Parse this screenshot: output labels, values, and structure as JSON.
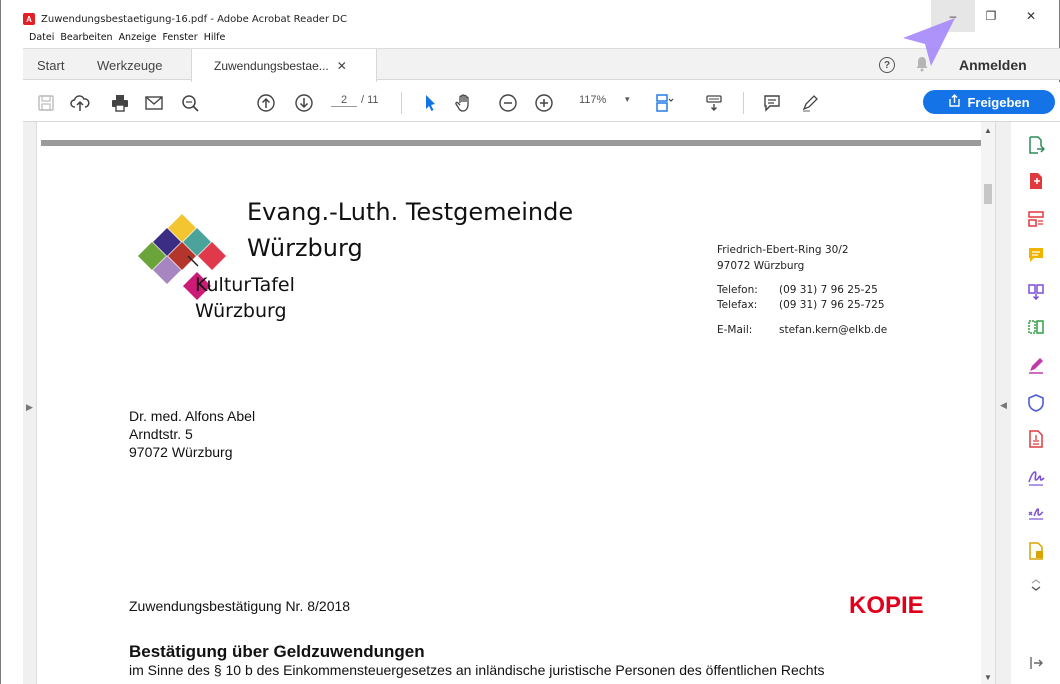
{
  "window": {
    "title": "Zuwendungsbestaetigung-16.pdf - Adobe Acrobat Reader DC",
    "controls": {
      "minimize": "–",
      "maximize": "❐",
      "close": "✕"
    }
  },
  "menu": [
    "Datei",
    "Bearbeiten",
    "Anzeige",
    "Fenster",
    "Hilfe"
  ],
  "tabs": {
    "start": "Start",
    "tools": "Werkzeuge",
    "document": "Zuwendungsbestae...",
    "close": "✕"
  },
  "header": {
    "help": "?",
    "signin": "Anmelden"
  },
  "toolbar": {
    "page_current": "2",
    "page_total": "/ 11",
    "zoom": "117%",
    "zoom_caret": "▾",
    "share_label": "Freigeben"
  },
  "letter": {
    "org_line1": "Evang.-Luth. Testgemeinde",
    "org_line2": "Würzburg",
    "logo_line1": "KulturTafel",
    "logo_line2": "Würzburg",
    "address_line1": "Friedrich-Ebert-Ring 30/2",
    "address_line2": "97072 Würzburg",
    "phone_label": "Telefon:",
    "phone_value": "(09 31) 7 96 25-25",
    "fax_label": "Telefax:",
    "fax_value": "(09 31) 7 96 25-725",
    "email_label": "E-Mail:",
    "email_value": "stefan.kern@elkb.de",
    "recipient_name": "Dr. med. Alfons Abel",
    "recipient_street": "Arndtstr. 5",
    "recipient_city": "97072 Würzburg",
    "confirmation_number": "Zuwendungsbestätigung Nr. 8/2018",
    "stamp": "KOPIE",
    "heading": "Bestätigung über Geldzuwendungen",
    "subline": "im Sinne des § 10 b des Einkommensteuergesetzes an inländische juristische Personen des öffentlichen Rechts"
  },
  "colors": {
    "accent": "#1473e6",
    "stamp": "#e0001b",
    "cursor": "#a78bfa"
  }
}
